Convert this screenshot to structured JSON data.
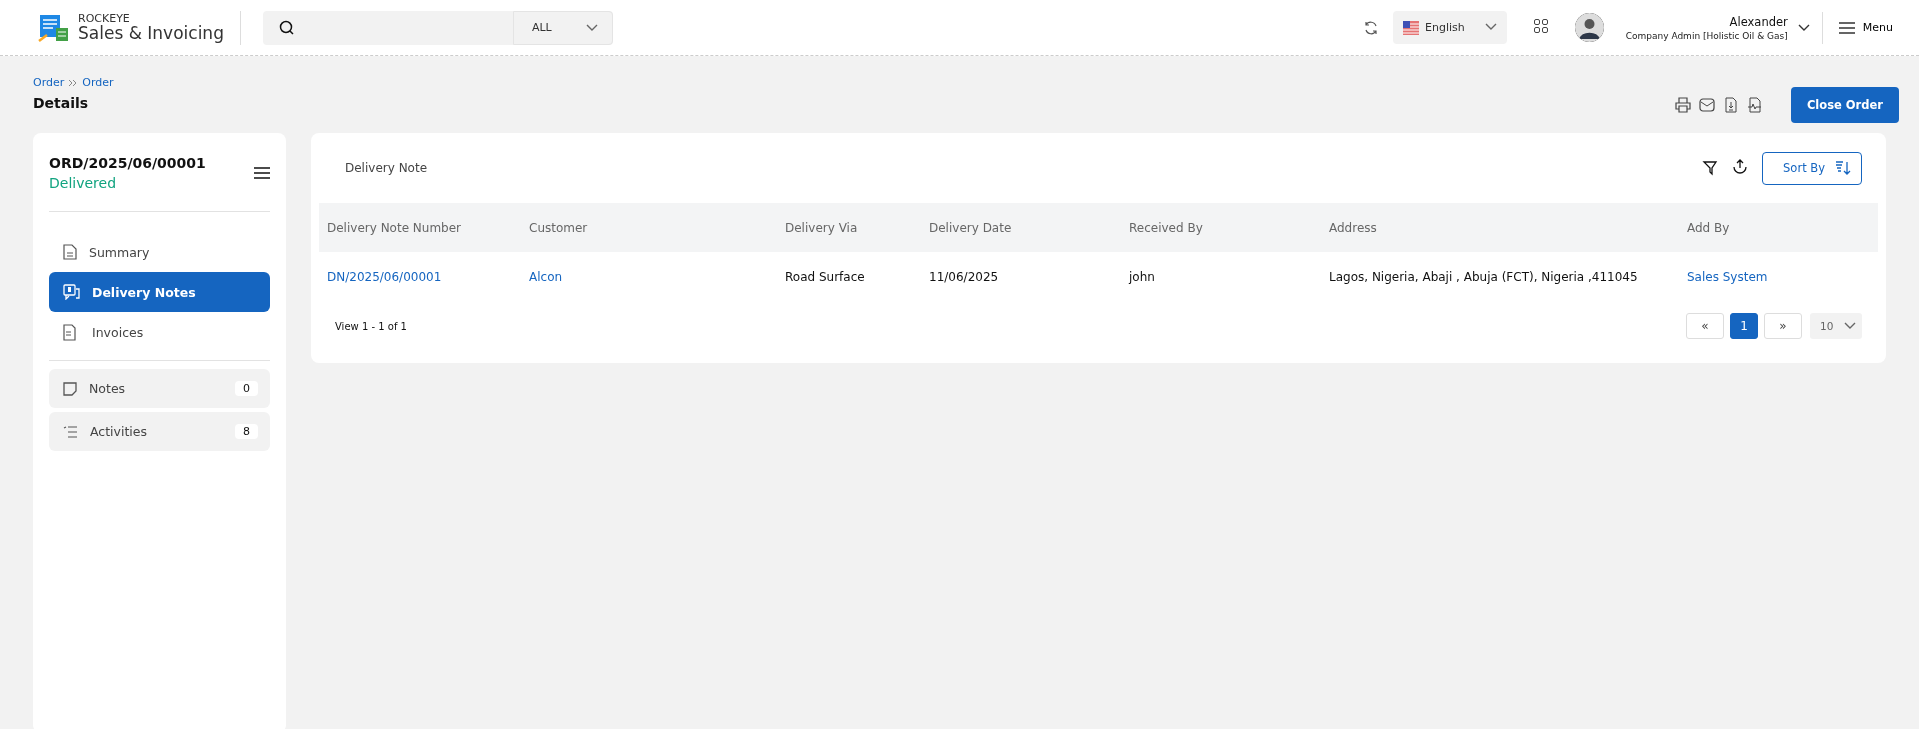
{
  "app": {
    "brand_top": "ROCKEYE",
    "brand_name": "Sales & Invoicing"
  },
  "search": {
    "scope": "ALL"
  },
  "language": {
    "label": "English"
  },
  "user": {
    "name": "Alexander",
    "role": "Company Admin [Holistic Oil & Gas]"
  },
  "menu": {
    "label": "Menu"
  },
  "breadcrumb": [
    "Order",
    "Order"
  ],
  "page_title": "Details",
  "close_button": "Close Order",
  "order": {
    "number": "ORD/2025/06/00001",
    "status": "Delivered"
  },
  "nav": [
    {
      "label": "Summary",
      "kind": "summary",
      "selected": false
    },
    {
      "label": "Delivery Notes",
      "kind": "delivery",
      "selected": true
    },
    {
      "label": "Invoices",
      "kind": "invoice",
      "selected": false
    }
  ],
  "extras": [
    {
      "label": "Notes",
      "count": "0",
      "kind": "notes"
    },
    {
      "label": "Activities",
      "count": "8",
      "kind": "activities"
    }
  ],
  "panel": {
    "title": "Delivery Note",
    "sort_label": "Sort By"
  },
  "table": {
    "columns": [
      "Delivery Note Number",
      "Customer",
      "Delivery Via",
      "Delivery Date",
      "Received By",
      "Address",
      "Add By"
    ],
    "rows": [
      {
        "cells": [
          "DN/2025/06/00001",
          "Alcon",
          "Road Surface",
          "11/06/2025",
          "john",
          "Lagos, Nigeria, Abaji , Abuja (FCT), Nigeria ,411045",
          "Sales System"
        ]
      }
    ]
  },
  "pagination": {
    "summary": "View 1 - 1 of 1",
    "prev": "«",
    "pages": [
      {
        "label": "1",
        "selected": true
      }
    ],
    "next": "»",
    "page_size": "10"
  }
}
